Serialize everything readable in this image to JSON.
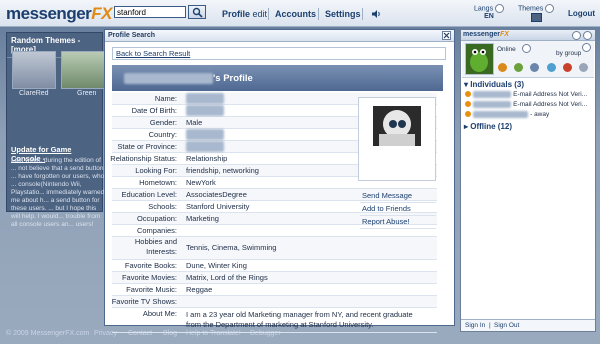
{
  "header": {
    "logo_main": "messenger",
    "logo_fx": "FX",
    "search_value": "stanford",
    "nav_profile": "Profile",
    "nav_edit": "edit",
    "nav_accounts": "Accounts",
    "nav_settings": "Settings",
    "langs_label": "Langs",
    "lang_value": "EN",
    "themes_label": "Themes",
    "logout": "Logout"
  },
  "left_panel": {
    "title": "Random Themes - [more]",
    "themes": [
      {
        "label": "ClareRed"
      },
      {
        "label": "Green"
      }
    ],
    "update_title": "Update for Game Console -",
    "update_text": "Last week, during the edition of ... not believe that a send button ... have forgotten our users, who ... console(Nintendo Wii, Playstatio... immediately warned me about h... a send button for these users. ... but I hope this will help. I would... trouble from all console users an... users!"
  },
  "dialog": {
    "title": "Profile Search",
    "back_link": "Back to Search Result",
    "profile_heading_suffix": "'s Profile",
    "fields": [
      {
        "label": "Name:",
        "value": "",
        "blurred": true
      },
      {
        "label": "Date Of Birth:",
        "value": "",
        "blurred": true
      },
      {
        "label": "Gender:",
        "value": "Male"
      },
      {
        "label": "Country:",
        "value": "",
        "blurred": true
      },
      {
        "label": "State or Province:",
        "value": "",
        "blurred": true
      },
      {
        "label": "Relationship Status:",
        "value": "Relationship"
      },
      {
        "label": "Looking For:",
        "value": "friendship, networking"
      },
      {
        "label": "Hometown:",
        "value": "NewYork"
      },
      {
        "label": "Education Level:",
        "value": "AssociatesDegree"
      },
      {
        "label": "Schools:",
        "value": "Stanford University"
      },
      {
        "label": "Occupation:",
        "value": "Marketing"
      },
      {
        "label": "Companies:",
        "value": ""
      },
      {
        "label": "Hobbies and Interests:",
        "value": "Tennis, Cinema, Swimming"
      },
      {
        "label": "Favorite Books:",
        "value": "Dune, Winter King"
      },
      {
        "label": "Favorite Movies:",
        "value": "Matrix, Lord of the Rings"
      },
      {
        "label": "Favorite Music:",
        "value": "Reggae"
      },
      {
        "label": "Favorite TV Shows:",
        "value": ""
      },
      {
        "label": "About Me:",
        "value": "I am a 23 year old Marketing manager from NY, and recent graduate from the Department of marketing at Stanford University."
      }
    ],
    "actions": [
      "Send Message",
      "Add to Friends",
      "Report Abuse!"
    ]
  },
  "right_panel": {
    "logo_main": "messenger",
    "logo_fx": "FX",
    "status": "Online",
    "group_mode": "by group",
    "individuals": "Individuals (3)",
    "contacts": [
      {
        "suffix": "E-mail Address Not Veri..."
      },
      {
        "suffix": "E-mail Address Not Veri..."
      },
      {
        "suffix": "- away"
      }
    ],
    "offline": "Offline (12)",
    "sign_in": "Sign In",
    "sign_out": "Sign Out"
  },
  "footer": {
    "copyright": "© 2009 MessengerFX.com",
    "links": [
      "Privacy",
      "Contact",
      "Blog",
      "Help to Translate!",
      "Debugger"
    ]
  },
  "colors": {
    "accent": "#e08a12",
    "primary": "#1b3f6f",
    "banner": "#5e76a0"
  }
}
